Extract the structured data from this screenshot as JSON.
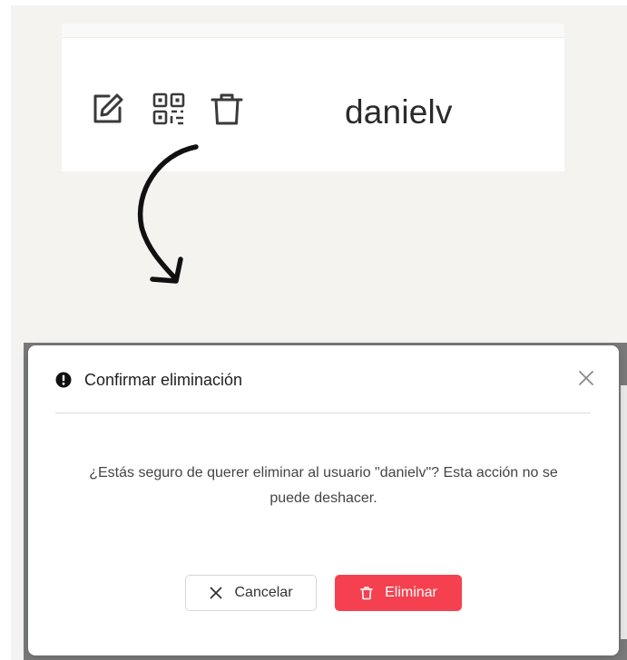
{
  "row": {
    "username": "danielv",
    "actions": [
      {
        "icon": "edit-icon"
      },
      {
        "icon": "qr-code-icon"
      },
      {
        "icon": "trash-icon"
      }
    ]
  },
  "dialog": {
    "title": "Confirmar eliminación",
    "message_line1": "¿Estás seguro de querer eliminar al usuario \"danielv\"? Esta acción no se",
    "message_line2": "puede deshacer.",
    "cancel_label": "Cancelar",
    "delete_label": "Eliminar",
    "icons": {
      "header": "exclamation-circle-icon",
      "close": "close-icon",
      "cancel": "x-icon",
      "delete": "trash-icon"
    }
  },
  "colors": {
    "danger": "#f5414f",
    "overlay": "#7a7a7a",
    "background": "#f4f3f0"
  }
}
